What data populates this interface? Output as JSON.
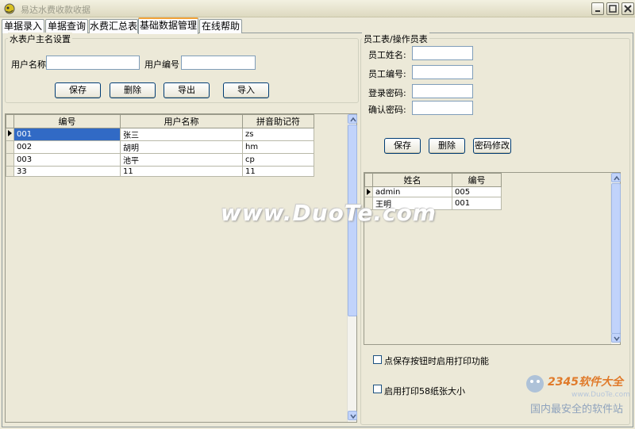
{
  "window": {
    "title": "易达水费收款收据"
  },
  "tabs": [
    {
      "label": "单据录入"
    },
    {
      "label": "单据查询"
    },
    {
      "label": "水费汇总表"
    },
    {
      "label": "基础数据管理"
    },
    {
      "label": "在线帮助"
    }
  ],
  "active_tab": 3,
  "water_user": {
    "group_title": "水表户主名设置",
    "name_label": "用户名称",
    "name_value": "",
    "code_label": "用户编号",
    "code_value": "",
    "buttons": {
      "save": "保存",
      "delete": "删除",
      "export": "导出",
      "import": "导入"
    },
    "columns": [
      "编号",
      "用户名称",
      "拼音助记符"
    ],
    "rows": [
      {
        "code": "001",
        "name": "张三",
        "pinyin": "zs"
      },
      {
        "code": "002",
        "name": "胡明",
        "pinyin": "hm"
      },
      {
        "code": "003",
        "name": "池平",
        "pinyin": "cp"
      },
      {
        "code": "33",
        "name": "11",
        "pinyin": "11"
      }
    ]
  },
  "staff": {
    "group_title": "员工表/操作员表",
    "name_label": "员工姓名:",
    "code_label": "员工编号:",
    "password_label": "登录密码:",
    "confirm_label": "确认密码:",
    "buttons": {
      "save": "保存",
      "delete": "删除",
      "change_password": "密码修改"
    },
    "columns": [
      "姓名",
      "编号"
    ],
    "rows": [
      {
        "name": "admin",
        "code": "005"
      },
      {
        "name": "王明",
        "code": "001"
      }
    ]
  },
  "options": {
    "print_on_save": "点保存按钮时启用打印功能",
    "print_58": "启用打印58纸张大小"
  },
  "watermarks": {
    "center": "www.DuoTe.com",
    "logo_brand": "2345软件大全",
    "logo_url": "www.DuoTe.com",
    "logo_slogan": "国内最安全的软件站"
  },
  "colors": {
    "accent_tab": "#f2a33a",
    "selection": "#316ac5",
    "window_bg": "#ece9d8"
  }
}
